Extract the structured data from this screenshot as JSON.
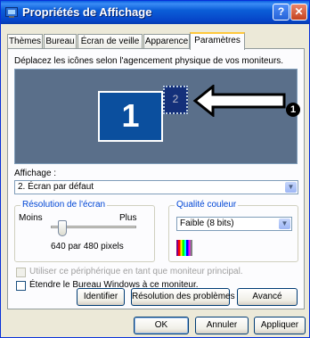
{
  "window": {
    "title": "Propriétés de Affichage",
    "help_label": "?",
    "close_label": "✕"
  },
  "tabs": [
    {
      "label": "Thèmes"
    },
    {
      "label": "Bureau"
    },
    {
      "label": "Écran de veille"
    },
    {
      "label": "Apparence"
    },
    {
      "label": "Paramètres",
      "active": true
    }
  ],
  "settings": {
    "description": "Déplacez les icônes selon l'agencement physique de vos moniteurs.",
    "monitor1_label": "1",
    "monitor2_label": "2",
    "callout_number": "1",
    "display_label": "Affichage :",
    "display_value": "2. Écran par défaut",
    "resolution": {
      "title": "Résolution de l'écran",
      "less": "Moins",
      "more": "Plus",
      "value": "640 par 480 pixels"
    },
    "color_quality": {
      "title": "Qualité couleur",
      "value": "Faible (8 bits)"
    },
    "checkbox_primary": "Utiliser ce périphérique en tant que moniteur principal.",
    "checkbox_extend": "Étendre le Bureau Windows à ce moniteur.",
    "identify_button": "Identifier",
    "troubleshoot_button": "Résolution des problèmes",
    "advanced_button": "Avancé"
  },
  "footer": {
    "ok": "OK",
    "cancel": "Annuler",
    "apply": "Appliquer"
  }
}
